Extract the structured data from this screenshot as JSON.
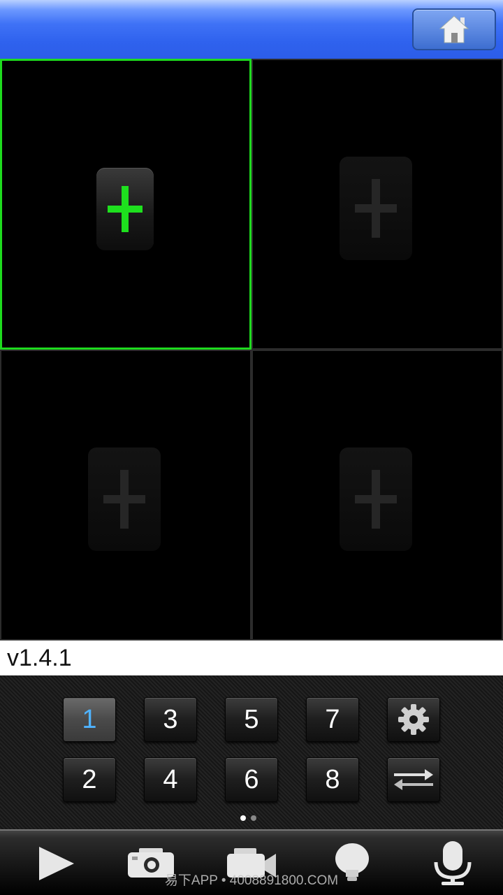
{
  "header": {
    "home_icon": "home-icon"
  },
  "grid": {
    "cells": [
      {
        "id": 1,
        "selected": true,
        "icon": "add-icon"
      },
      {
        "id": 2,
        "selected": false,
        "icon": "add-icon"
      },
      {
        "id": 3,
        "selected": false,
        "icon": "add-icon"
      },
      {
        "id": 4,
        "selected": false,
        "icon": "add-icon"
      }
    ]
  },
  "version": "v1.4.1",
  "channels": {
    "row1": [
      "1",
      "3",
      "5",
      "7"
    ],
    "row2": [
      "2",
      "4",
      "6",
      "8"
    ],
    "selected": "1",
    "settings_icon": "gear-icon",
    "switch_icon": "switch-arrows-icon"
  },
  "pager": {
    "pages": 2,
    "current": 1
  },
  "toolbar": {
    "items": [
      "play-icon",
      "camera-icon",
      "video-camera-icon",
      "light-bulb-icon",
      "microphone-icon"
    ]
  },
  "watermark": "易下APP • 4008891800.COM",
  "colors": {
    "accent_green": "#1edb1e",
    "header_blue": "#2f62ee",
    "active_channel": "#4fb3ff"
  }
}
